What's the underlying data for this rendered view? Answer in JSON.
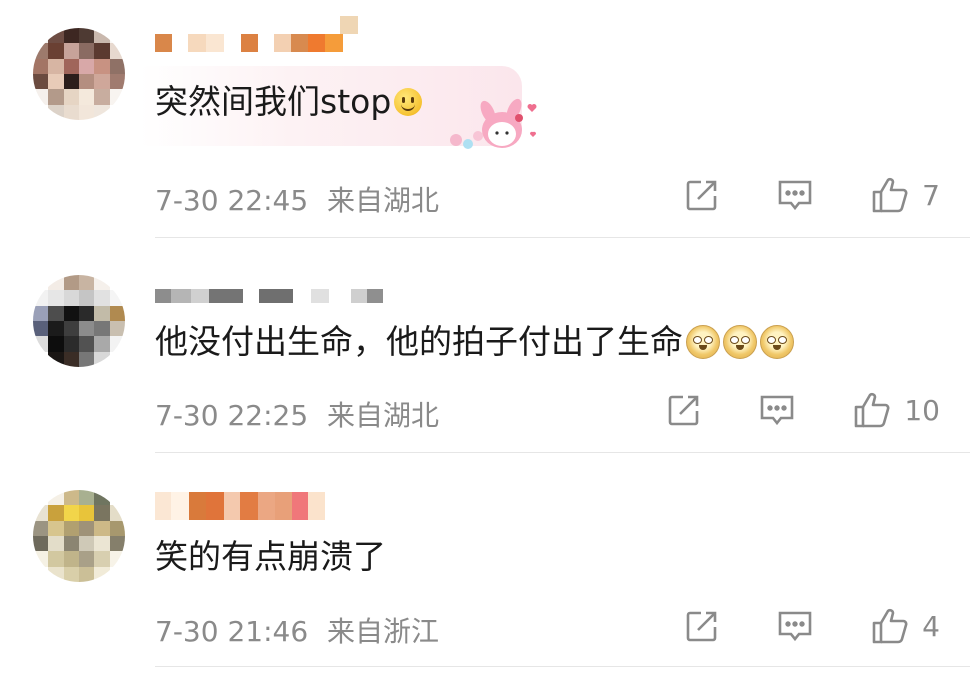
{
  "comments": [
    {
      "text": "突然间我们stop",
      "time": "7-30 22:45",
      "location": "来自湖北",
      "likes": "7",
      "emoji": [
        "smile-emoji"
      ],
      "decoration": "my-melody-sticker"
    },
    {
      "text": "他没付出生命，他的拍子付出了生命",
      "time": "7-30 22:25",
      "location": "来自湖北",
      "likes": "10",
      "emoji": [
        "doge-emoji",
        "doge-emoji",
        "doge-emoji"
      ]
    },
    {
      "text": "笑的有点崩溃了",
      "time": "7-30 21:46",
      "location": "来自浙江",
      "likes": "4",
      "emoji": []
    }
  ],
  "icons": {
    "share": "share-icon",
    "reply": "comment-icon",
    "like": "thumbs-up-icon"
  },
  "colors": {
    "meta_text": "#8a8a8a",
    "body_text": "#1a1a1a",
    "divider": "#e6e6e6",
    "icon": "#8a8a8a",
    "bubble_pink": "#fbe6ec"
  }
}
